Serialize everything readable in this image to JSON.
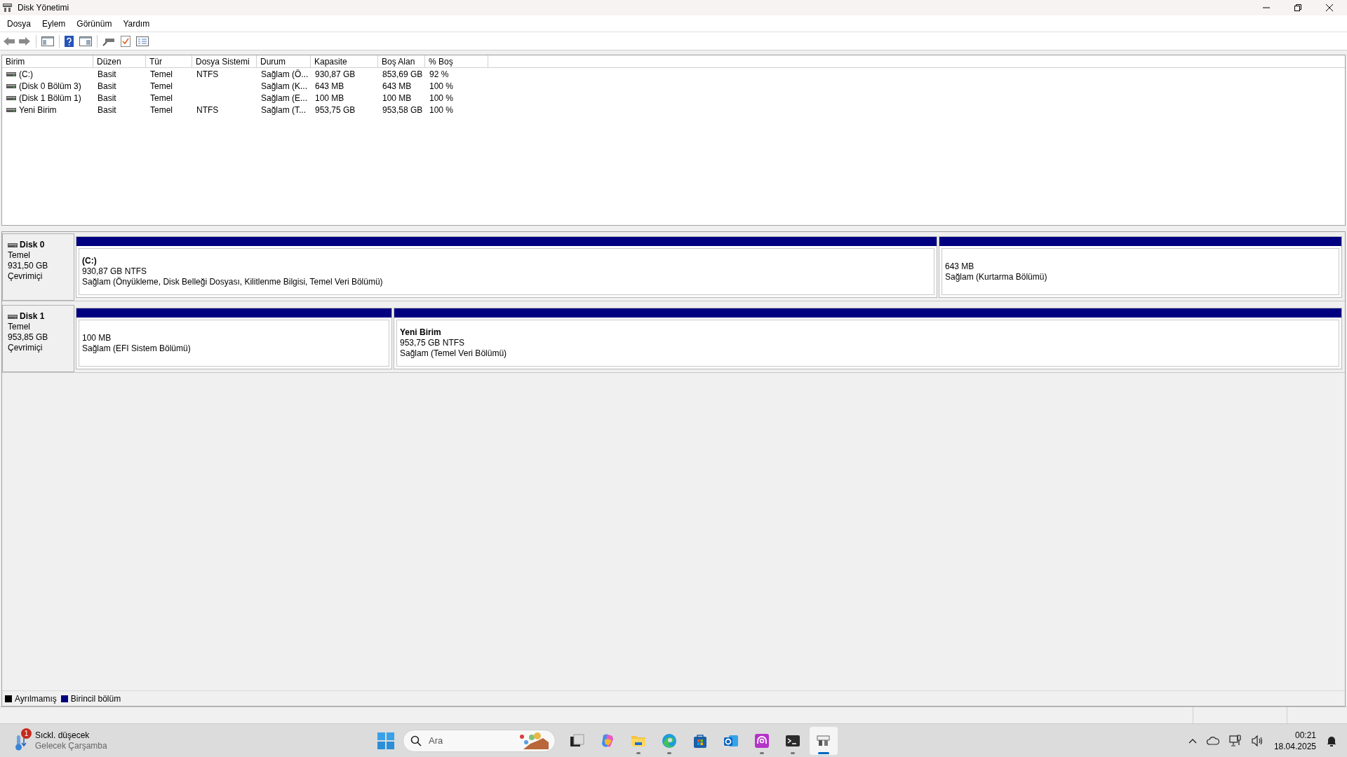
{
  "window": {
    "title": "Disk Yönetimi"
  },
  "menu": [
    "Dosya",
    "Eylem",
    "Görünüm",
    "Yardım"
  ],
  "table": {
    "columns": [
      "Birim",
      "Düzen",
      "Tür",
      "Dosya Sistemi",
      "Durum",
      "Kapasite",
      "Boş Alan",
      "% Boş"
    ],
    "rows": [
      {
        "cells": [
          "(C:)",
          "Basit",
          "Temel",
          "NTFS",
          "Sağlam (Ö...",
          "930,87 GB",
          "853,69 GB",
          "92 %"
        ]
      },
      {
        "cells": [
          "(Disk 0 Bölüm 3)",
          "Basit",
          "Temel",
          "",
          "Sağlam (K...",
          "643 MB",
          "643 MB",
          "100 %"
        ]
      },
      {
        "cells": [
          "(Disk 1 Bölüm 1)",
          "Basit",
          "Temel",
          "",
          "Sağlam (E...",
          "100 MB",
          "100 MB",
          "100 %"
        ]
      },
      {
        "cells": [
          "Yeni Birim",
          "Basit",
          "Temel",
          "NTFS",
          "Sağlam (T...",
          "953,75 GB",
          "953,58 GB",
          "100 %"
        ]
      }
    ]
  },
  "disks": [
    {
      "name": "Disk 0",
      "type": "Temel",
      "size": "931,50 GB",
      "state": "Çevrimiçi",
      "partitions": [
        {
          "label": "(C:)",
          "size": "930,87 GB NTFS",
          "status": "Sağlam (Önyükleme, Disk Belleği Dosyası, Kilitlenme Bilgisi, Temel Veri Bölümü)"
        },
        {
          "size": "643 MB",
          "status": "Sağlam (Kurtarma Bölümü)"
        }
      ]
    },
    {
      "name": "Disk 1",
      "type": "Temel",
      "size": "953,85 GB",
      "state": "Çevrimiçi",
      "partitions": [
        {
          "size": "100 MB",
          "status": "Sağlam (EFI Sistem Bölümü)"
        },
        {
          "label": "Yeni Birim",
          "size": "953,75 GB NTFS",
          "status": "Sağlam (Temel Veri Bölümü)"
        }
      ]
    }
  ],
  "legend": [
    {
      "label": "Ayrılmamış",
      "color": "#000000"
    },
    {
      "label": "Birincil bölüm",
      "color": "#000080"
    }
  ],
  "taskbar": {
    "weather": {
      "badge": "1",
      "title": "Sıckl. düşecek",
      "subtitle": "Gelecek Çarşamba"
    },
    "search": {
      "placeholder": "Ara"
    },
    "apps": [
      {
        "kind": "taskview",
        "running": false,
        "selected": false
      },
      {
        "kind": "copilot",
        "running": false,
        "selected": false
      },
      {
        "kind": "folder",
        "running": true,
        "selected": false
      },
      {
        "kind": "browser",
        "running": true,
        "selected": false
      },
      {
        "kind": "store",
        "running": false,
        "selected": false
      },
      {
        "kind": "mail",
        "running": false,
        "selected": false
      },
      {
        "kind": "podcast",
        "running": true,
        "selected": false
      },
      {
        "kind": "terminal",
        "running": true,
        "selected": false
      },
      {
        "kind": "disk",
        "running": true,
        "selected": true
      }
    ],
    "time": "00:21",
    "date": "18.04.2025"
  }
}
